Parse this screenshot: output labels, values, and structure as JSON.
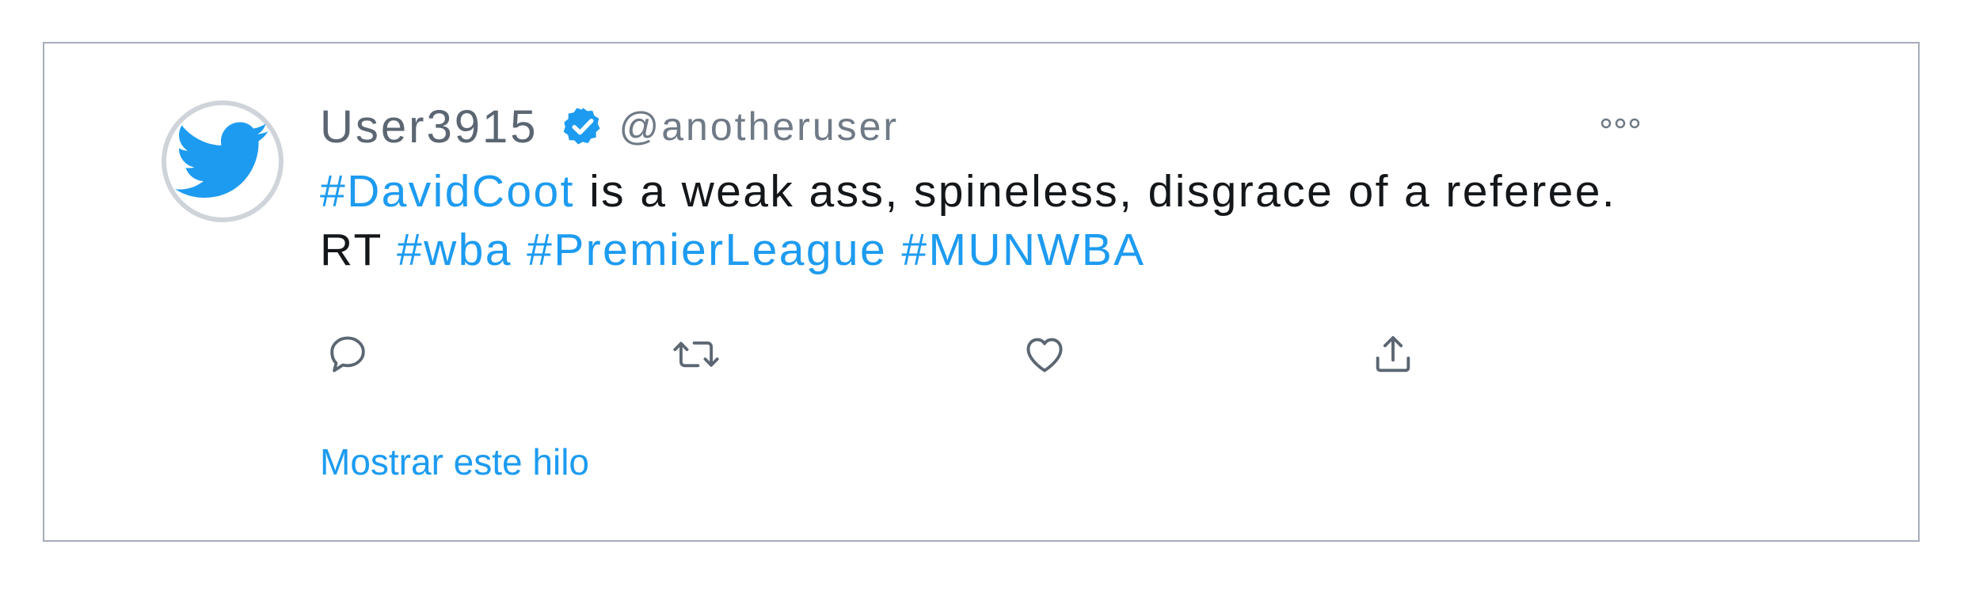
{
  "tweet": {
    "display_name": "User3915",
    "handle": "@anotheruser",
    "text_parts": [
      {
        "text": "#DavidCoot",
        "hashtag": true
      },
      {
        "text": " is a weak ass, spineless, disgrace of a referee.",
        "hashtag": false
      },
      {
        "text": "RT ",
        "hashtag": false
      },
      {
        "text": "#wba",
        "hashtag": true
      },
      {
        "text": "#PremierLeague",
        "hashtag": true
      },
      {
        "text": "#MUNWBA",
        "hashtag": true
      }
    ],
    "show_thread_label": "Mostrar este hilo"
  },
  "icons": {
    "avatar": "twitter-bird-icon",
    "verified": "verified-badge-icon",
    "more": "more-options-icon",
    "reply": "reply-icon",
    "retweet": "retweet-icon",
    "like": "like-icon",
    "share": "share-icon"
  },
  "colors": {
    "hashtag": "#1d9bf0",
    "text": "#14171a",
    "muted": "#5b6672",
    "bird": "#1d9bf0",
    "border": "#a6adba"
  }
}
